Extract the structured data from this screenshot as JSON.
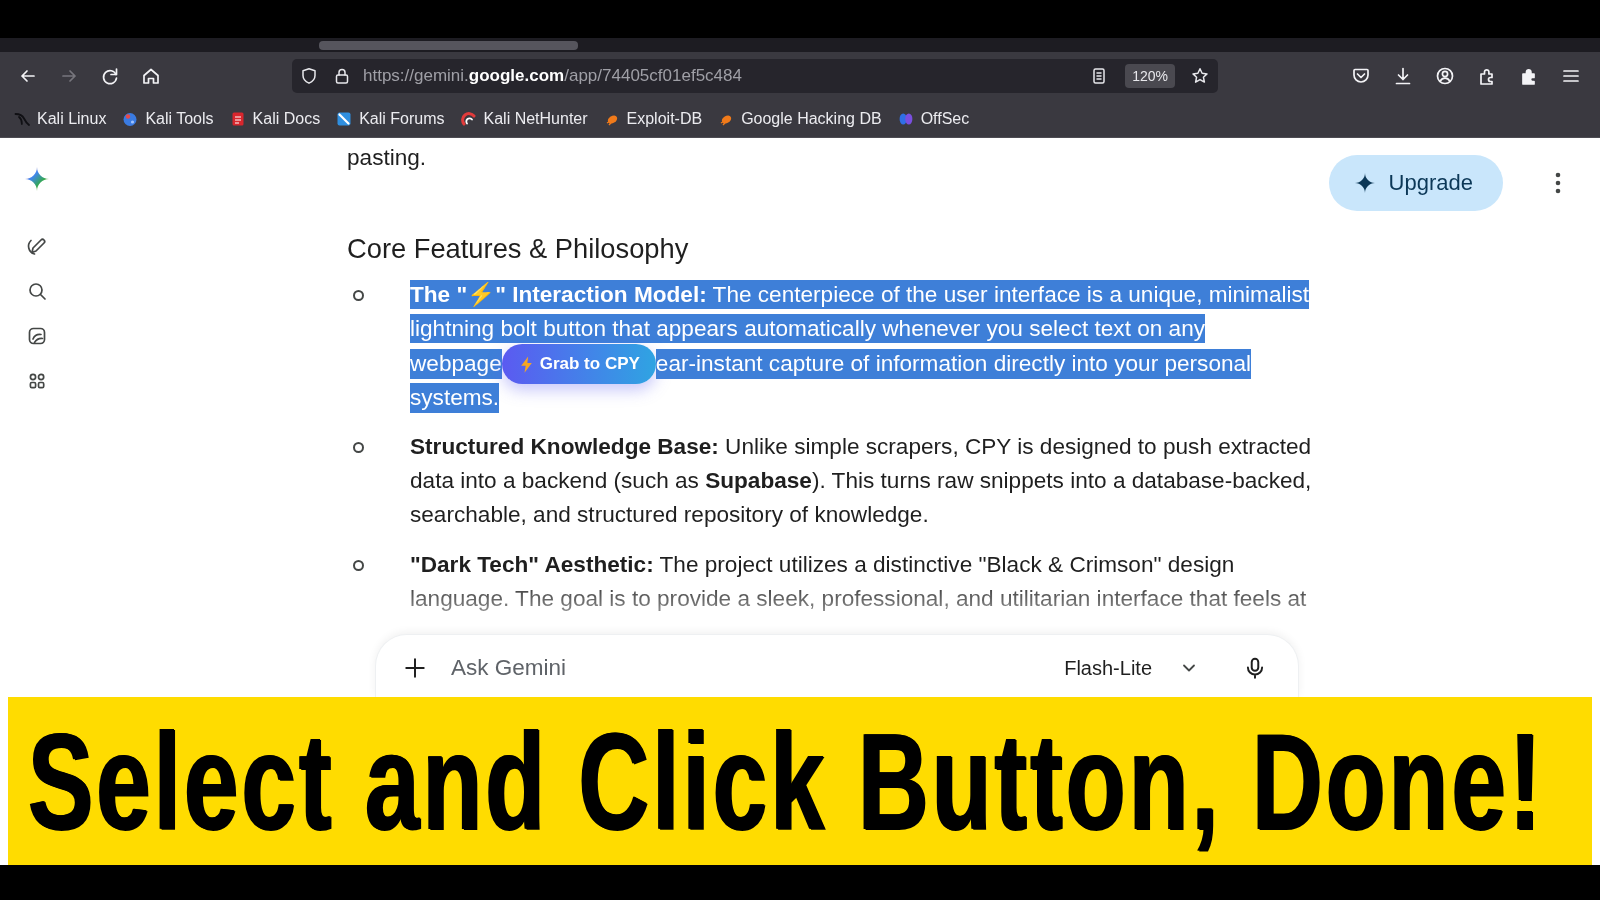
{
  "browser": {
    "back_disabled": false,
    "forward_disabled": true,
    "url": "https://gemini.**google.com**/app/74405cf01ef5c484",
    "zoom_level": "120%"
  },
  "bookmarks": [
    {
      "label": "Kali Linux"
    },
    {
      "label": "Kali Tools"
    },
    {
      "label": "Kali Docs"
    },
    {
      "label": "Kali Forums"
    },
    {
      "label": "Kali NetHunter"
    },
    {
      "label": "Exploit-DB"
    },
    {
      "label": "Google Hacking DB"
    },
    {
      "label": "OffSec"
    }
  ],
  "header": {
    "upgrade_label": "Upgrade"
  },
  "content": {
    "lead_fragment": "pasting.",
    "heading": "Core Features & Philosophy",
    "items": [
      {
        "selected": true,
        "segments": [
          {
            "kind": "text",
            "text": "**The \"⚡\" Interaction Model:** The centerpiece of the user interface is a unique, minimalist lightning bolt button that appears automatically whenever you select text on any"
          },
          {
            "kind": "text",
            "text": "webpage"
          },
          {
            "kind": "popup",
            "text": "Grab to CPY"
          },
          {
            "kind": "text",
            "text": "ear-instant capture of information directly into your personal"
          },
          {
            "kind": "text",
            "text": "systems."
          }
        ]
      },
      {
        "selected": false,
        "text": "**Structured Knowledge Base:** Unlike simple scrapers, CPY is designed to push extracted data into a backend (such as **Supabase**). This turns raw snippets into a database-backed, searchable, and structured repository of knowledge."
      },
      {
        "selected": false,
        "text": "**\"Dark Tech\" Aesthetic:** The project utilizes a distinctive \"Black & Crimson\" design language. The goal is to provide a sleek, professional, and utilitarian interface that feels at"
      }
    ]
  },
  "composer": {
    "placeholder": "Ask Gemini",
    "model": "Flash-Lite"
  },
  "caption": "Select and Click Button, Done!"
}
